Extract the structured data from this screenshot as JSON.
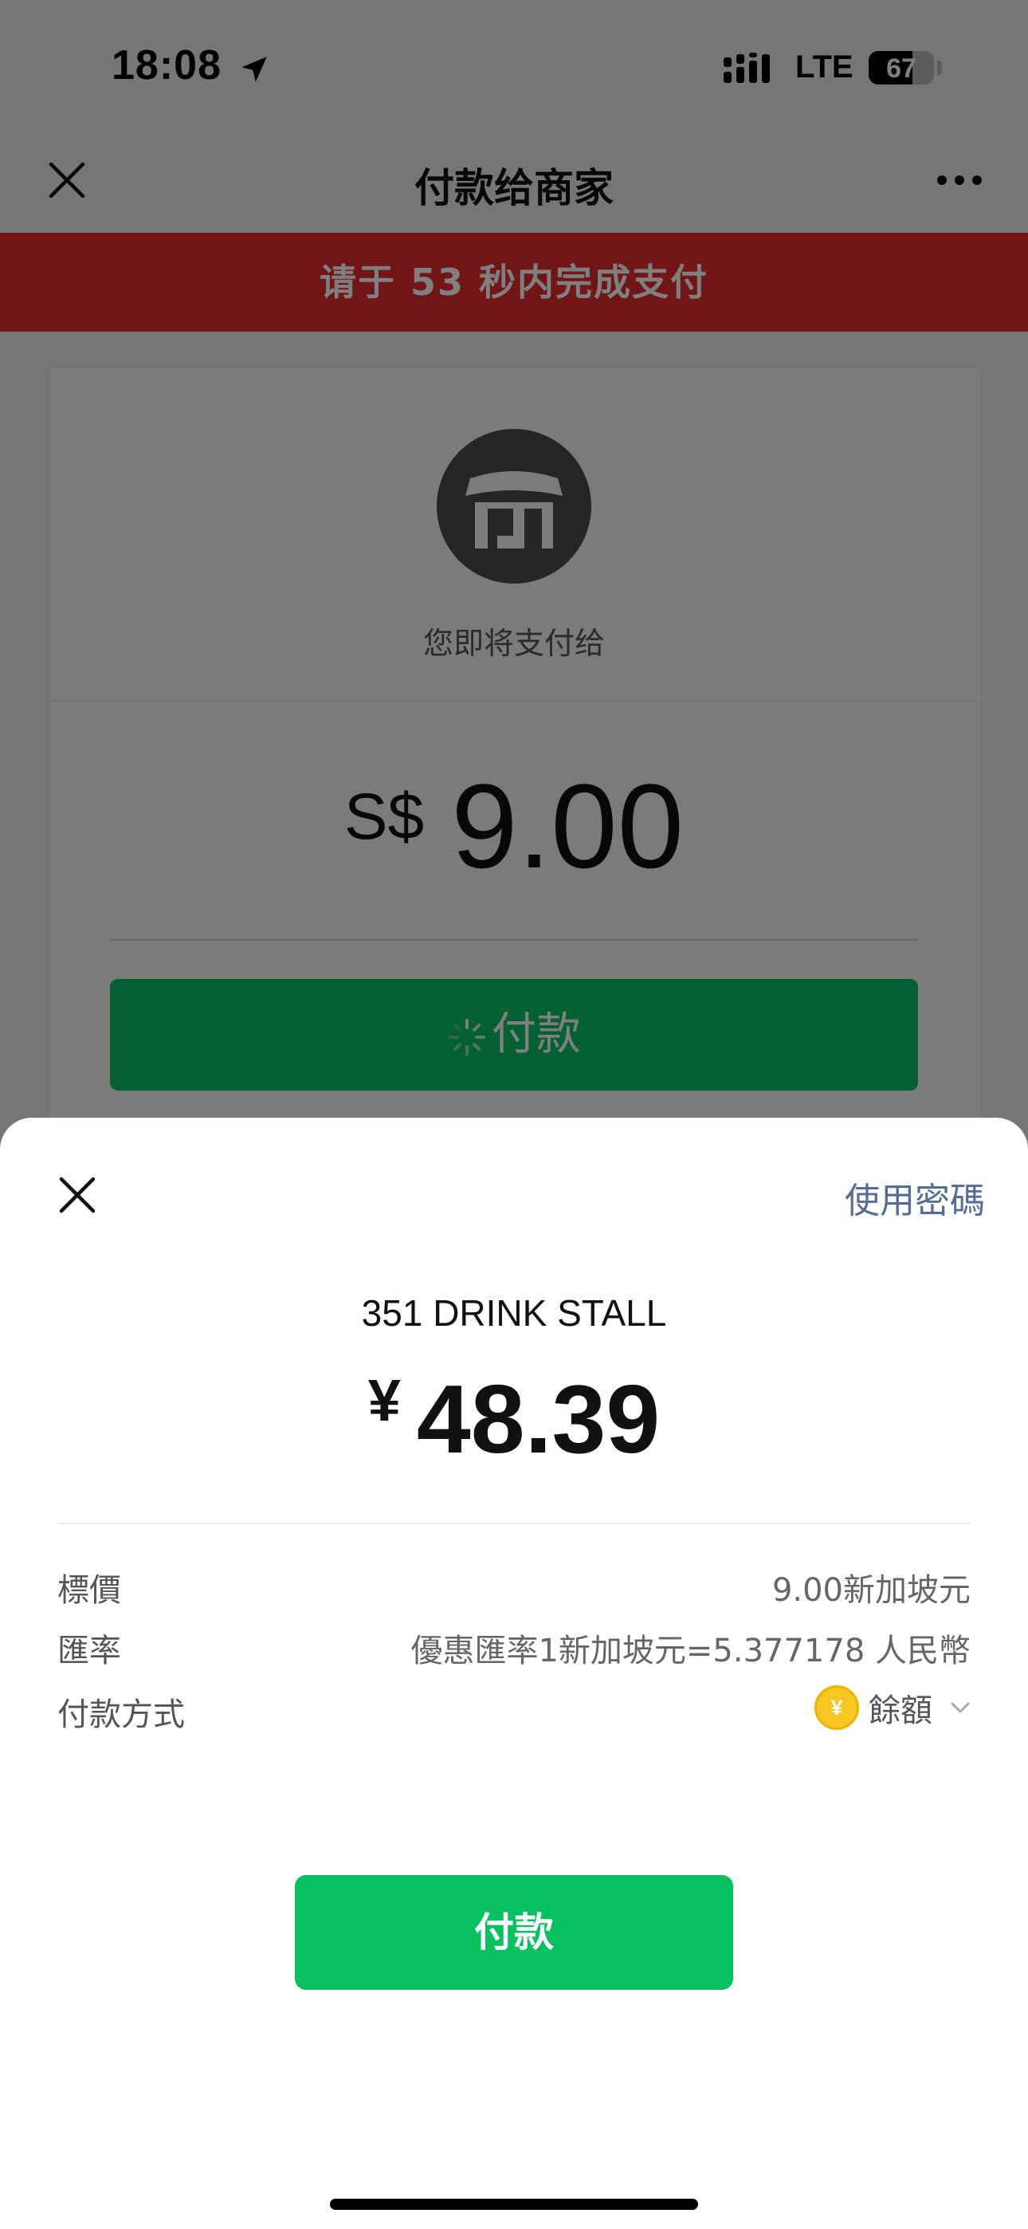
{
  "status_bar": {
    "time": "18:08",
    "network": "LTE",
    "battery_level": "67",
    "battery_fraction": 0.67
  },
  "nav": {
    "title": "付款给商家",
    "close_icon": "close-icon",
    "more_icon": "more-icon"
  },
  "countdown": {
    "text": "请于 53 秒内完成支付"
  },
  "payment_card": {
    "payto_label": "您即将支付给",
    "currency": "S$",
    "amount": "9.00",
    "pay_button_label": "付款",
    "store_icon": "store-icon"
  },
  "sheet": {
    "use_password_label": "使用密碼",
    "merchant_name": "351 DRINK STALL",
    "currency_symbol": "¥",
    "amount": "48.39",
    "rows": {
      "list_price_label": "標價",
      "list_price_value": "9.00新加坡元",
      "exchange_rate_label": "匯率",
      "exchange_rate_value": "優惠匯率1新加坡元=5.377178 人民幣",
      "payment_method_label": "付款方式",
      "payment_method_value": "餘額"
    },
    "coin_glyph": "¥",
    "pay_button_label": "付款"
  },
  "colors": {
    "countdown_banner": "#e22b2d",
    "primary_green": "#07c160",
    "link_blue": "#576b95",
    "coin_yellow": "#f6c623"
  }
}
